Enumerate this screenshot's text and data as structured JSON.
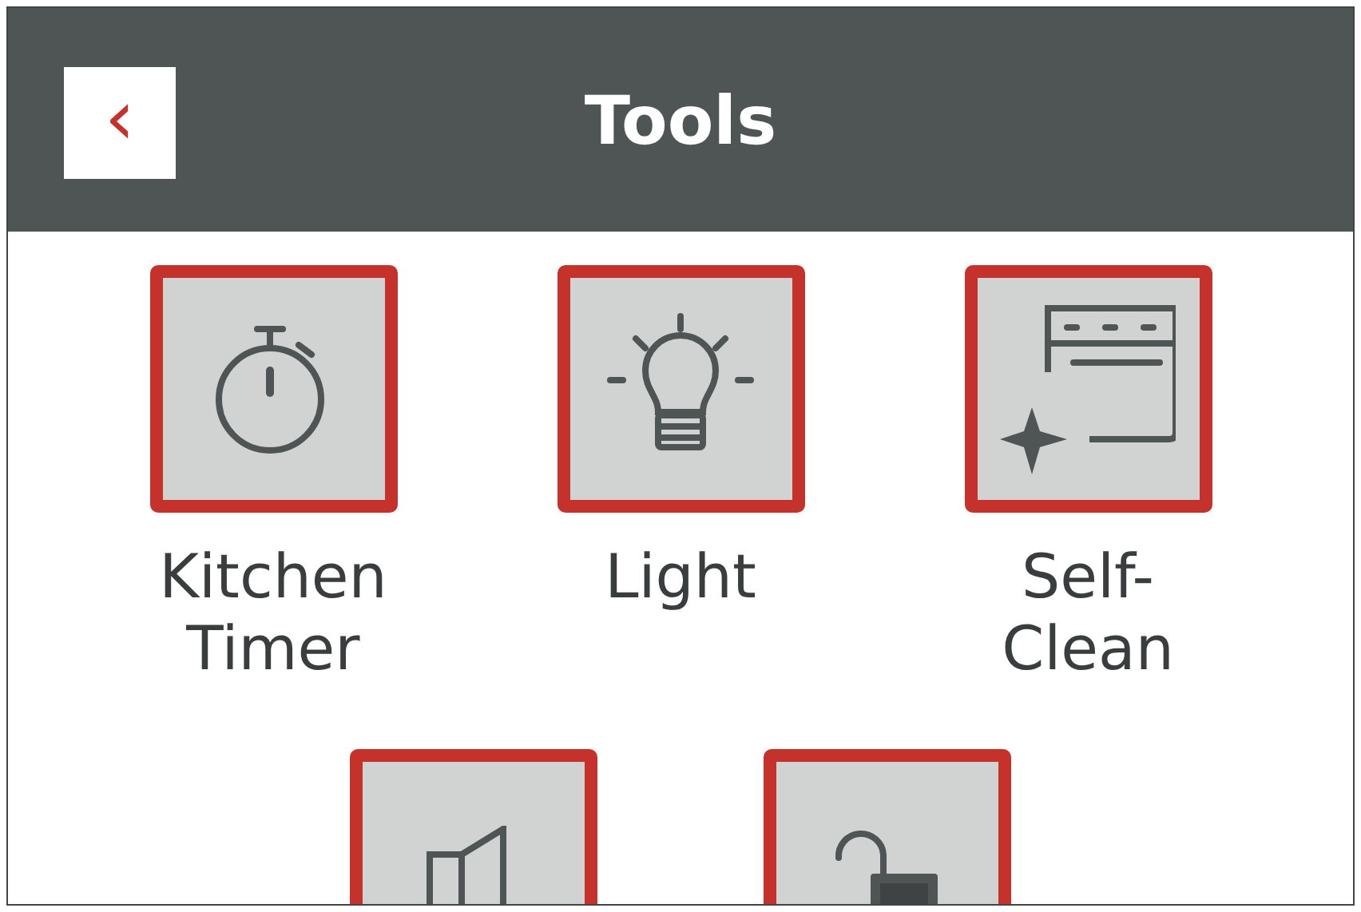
{
  "header": {
    "title": "Tools",
    "back_icon": "‹"
  },
  "tools": [
    {
      "kind": "timer",
      "label": "Kitchen Timer"
    },
    {
      "kind": "light",
      "label": "Light"
    },
    {
      "kind": "clean",
      "label": "Self-Clean"
    },
    {
      "kind": "door"
    },
    {
      "kind": "lock"
    }
  ]
}
